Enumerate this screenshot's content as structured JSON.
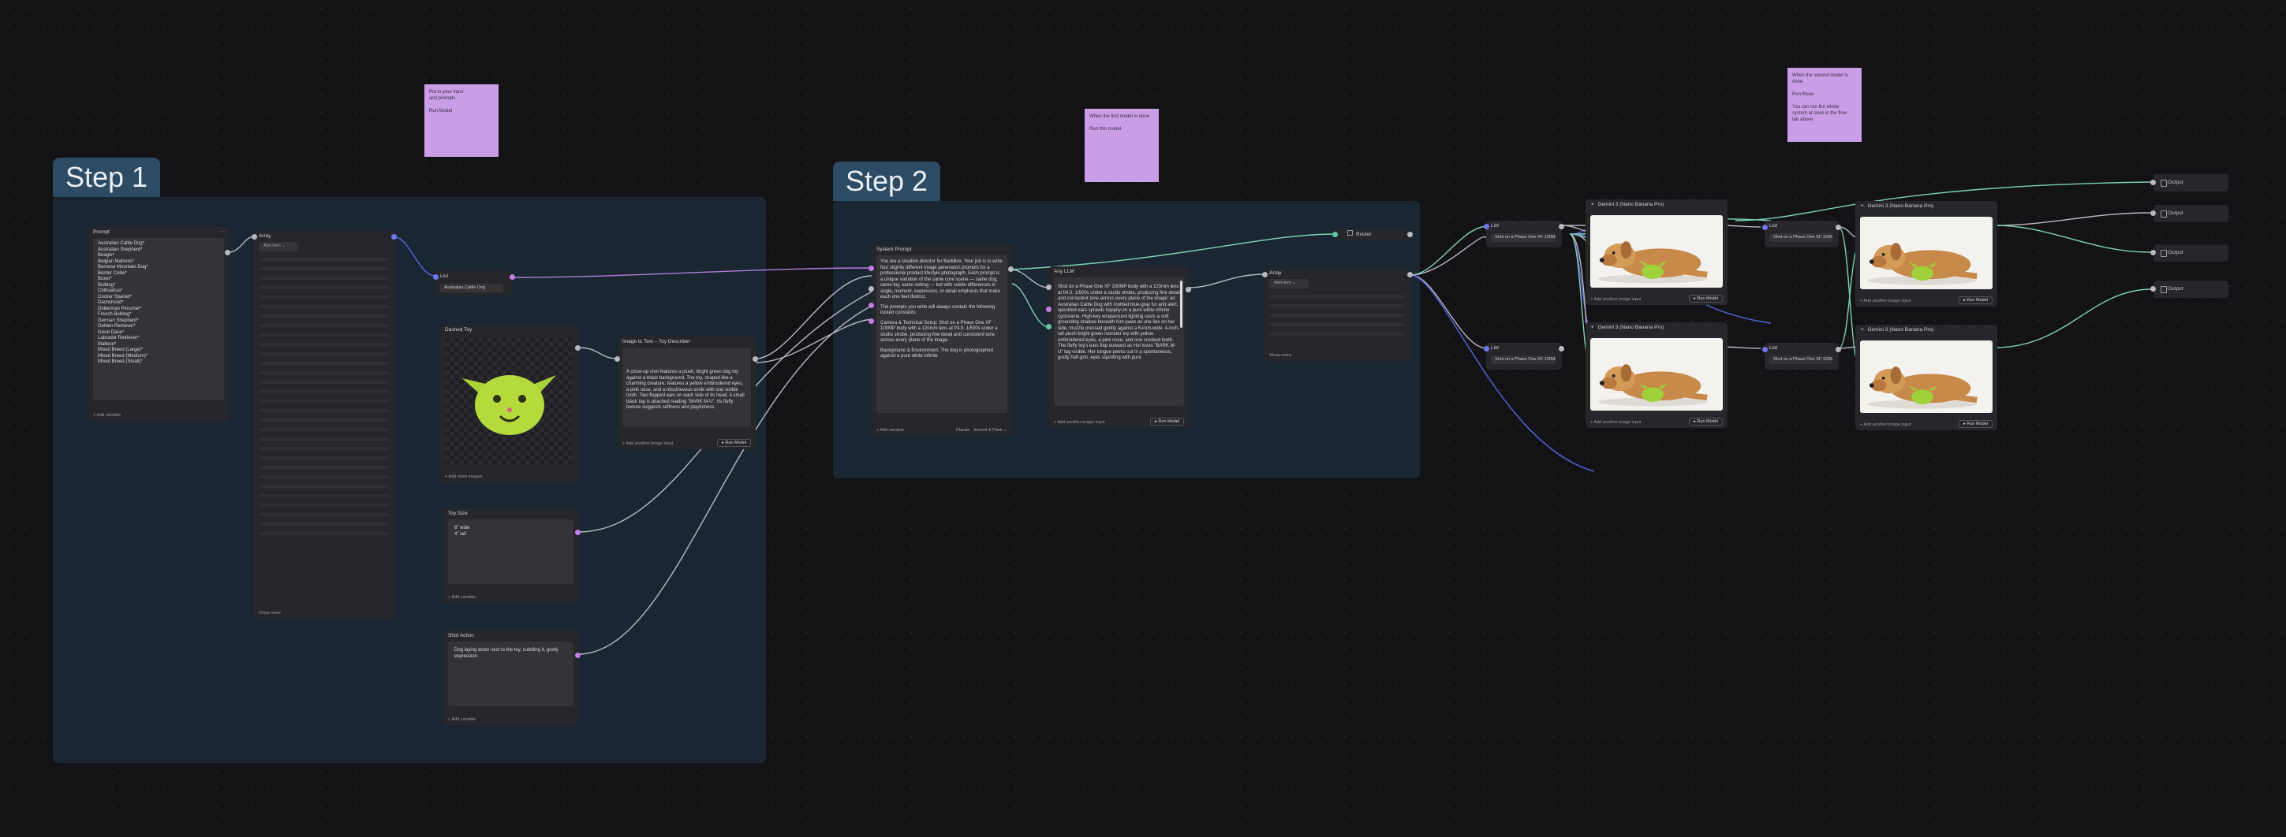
{
  "groups": {
    "step1": "Step 1",
    "step2": "Step 2"
  },
  "stickies": {
    "s1": "Put in your input\nand prompts\n\nRun Model",
    "s2": "When the first model is done\n\nRun this model",
    "s3": "When the second model is\ndone\n\nRun these\n\nYou can run the whole\nsystem at once in the flow\ntab above"
  },
  "nodes": {
    "prompt": {
      "title": "Prompt",
      "footer": "Add variable",
      "breeds": [
        "Australian Cattle Dog*",
        "Australian Shepherd*",
        "Beagle*",
        "Belgian Malinois*",
        "Bernese Mountain Dog*",
        "Border Collie*",
        "Boxer*",
        "Bulldog*",
        "Chihuahua*",
        "Cocker Spaniel*",
        "Dachshund*",
        "Doberman Pinscher*",
        "French Bulldog*",
        "German Shepherd*",
        "Golden Retriever*",
        "Great Dane*",
        "Labrador Retriever*",
        "Maltese*",
        "Mixed Breed (Large)*",
        "Mixed Breed (Medium)*",
        "Mixed Breed (Small)*"
      ]
    },
    "array1": {
      "title": "Array",
      "add": "Add item",
      "footer": "Show more"
    },
    "list1": {
      "title": "List",
      "value": "Australian Cattle Dog"
    },
    "dashed": {
      "title": "Dashed Toy",
      "footer": "Add more images"
    },
    "i2t": {
      "title": "Image to Text – Toy Describer",
      "text": "A close-up shot features a plush, bright green dog toy against a black background. The toy, shaped like a charming creature, features a yellow embroidered eyes, a pink nose, and a mischievous smile with one visible tooth. Two flapped ears on each side of its head. A small black tag is attached reading \"BARK M-U\". Its fluffy texture suggests softness and playfulness.",
      "add": "Add another image input",
      "run": "Run Model"
    },
    "toysize": {
      "title": "Toy Size",
      "lines": [
        "6\" wide",
        "4\" tall"
      ],
      "footer": "Add variable"
    },
    "shot": {
      "title": "Shot Action",
      "text": "Dog laying down next to the toy, cuddling it, goofy expression.",
      "footer": "Add variable"
    },
    "system": {
      "title": "System Prompt",
      "p1": "You are a creative director for BarkBox. Your job is to write four slightly different image generation prompts for a professional product lifestyle photograph. Each prompt is a unique variation of the same core scene — same dog, same toy, same setting — but with subtle differences in angle, moment, expression, or detail emphasis that make each one feel distinct.",
      "p2": "The prompts you write will always contain the following locked constants:",
      "p3": "Camera & Technical Setup: Shot on a Phase One XF 100MP body with a 120mm lens at f/4.0, 1/500s under a studio strobe, producing fine detail and consistent tone across every plane of the image.",
      "p4": "Background & Environment: The dog is photographed against a pure white infinite",
      "footer": "Add variable",
      "model": "Claude",
      "select": "Sonnet 4 Think"
    },
    "anyllm": {
      "title": "Any LLM",
      "text": "Shot on a Phase One XF 100MP body with a 120mm lens at f/4.0, 1/500s under a studio strobe, producing fine detail and consistent tone across every plane of the image: an Australian Cattle Dog with mottled blue-gray fur and alert, speckled ears sprawls happily on a pure white infinite cyclorama. High-key wraparound lighting casts a soft grounding shadow beneath him paws as she lies on her side, muzzle pressed gently against a 6-inch-wide, 4-inch-tall plush bright green monster toy with yellow embroidered eyes, a pink nose, and one crooked tooth. The fluffy toy's ears flap outward as Hut loves \"BARK M-U\" tag visible. Her tongue peeks out in a spontaneous, goofy half-grin, eyes squinting with pure",
      "add": "Add another image input",
      "run": "Run Model"
    },
    "router": {
      "title": "Router"
    },
    "array2": {
      "title": "Array",
      "add": "Add item",
      "footer": "Show more"
    },
    "listA": {
      "title": "List",
      "value": "Shot on a Phase One XF 100MP..."
    },
    "listB": {
      "title": "List",
      "value": "Shot on a Phase One XF 100MP..."
    },
    "gem1": {
      "title": "Gemini 3 (Nano Banana Pro)",
      "add": "Add another image input",
      "run": "Run Model"
    },
    "gem2": {
      "title": "Gemini 3 (Nano Banana Pro)",
      "add": "Add another image input",
      "run": "Run Model"
    },
    "listC": {
      "title": "List",
      "value": "Shot on a Phase One XF 100MP..."
    },
    "listD": {
      "title": "List",
      "value": "Shot on a Phase One XF 100MP..."
    },
    "gem3": {
      "title": "Gemini 3 (Nano Banana Pro)",
      "add": "Add another image input",
      "run": "Run Model"
    },
    "gem4": {
      "title": "Gemini 3 (Nano Banana Pro)",
      "add": "Add another image input",
      "run": "Run Model"
    }
  },
  "outputs": [
    "Output",
    "Output",
    "Output",
    "Output"
  ],
  "colors": {
    "canvas": "#131316",
    "group": "#1a2733",
    "group_tag": "#2d4b63",
    "sticky": "#c99ee6",
    "node": "#26262b",
    "wire_white": "#b8b8c0",
    "wire_blue": "#5c64e0",
    "wire_teal": "#7fd1b2",
    "wire_purple": "#b27bd6"
  }
}
